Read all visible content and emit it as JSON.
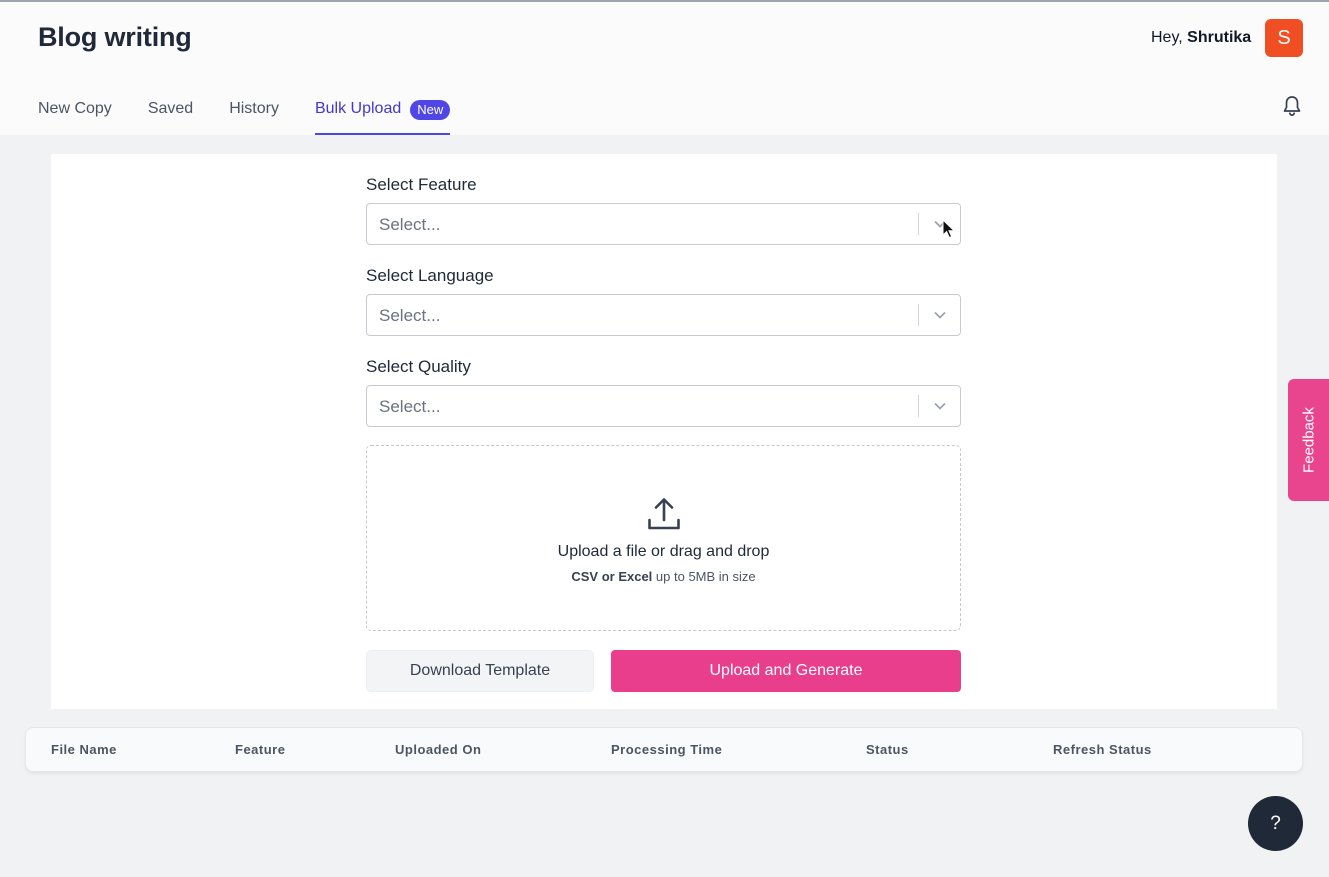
{
  "header": {
    "title": "Blog writing",
    "greeting_prefix": "Hey,",
    "user_name": "Shrutika",
    "avatar_letter": "S",
    "avatar_color": "#f04e23",
    "notification_icon": "bell-icon"
  },
  "tabs": [
    {
      "label": "New Copy",
      "active": false
    },
    {
      "label": "Saved",
      "active": false
    },
    {
      "label": "History",
      "active": false
    },
    {
      "label": "Bulk Upload",
      "active": true,
      "badge": "New"
    }
  ],
  "form": {
    "feature": {
      "label": "Select Feature",
      "placeholder": "Select..."
    },
    "language": {
      "label": "Select Language",
      "placeholder": "Select..."
    },
    "quality": {
      "label": "Select Quality",
      "placeholder": "Select..."
    },
    "dropzone": {
      "icon": "upload-icon",
      "main_text": "Upload a file or drag and drop",
      "formats": "CSV or Excel",
      "size_note": "up to 5MB in size"
    },
    "download_template_label": "Download Template",
    "upload_generate_label": "Upload and Generate"
  },
  "table": {
    "columns": [
      "File Name",
      "Feature",
      "Uploaded On",
      "Processing Time",
      "Status",
      "Refresh Status"
    ]
  },
  "feedback_label": "Feedback",
  "help_label": "?",
  "colors": {
    "accent": "#4f46e5",
    "primary_button": "#e83e8c",
    "feedback": "#e8458e",
    "help_button": "#1f2937"
  }
}
